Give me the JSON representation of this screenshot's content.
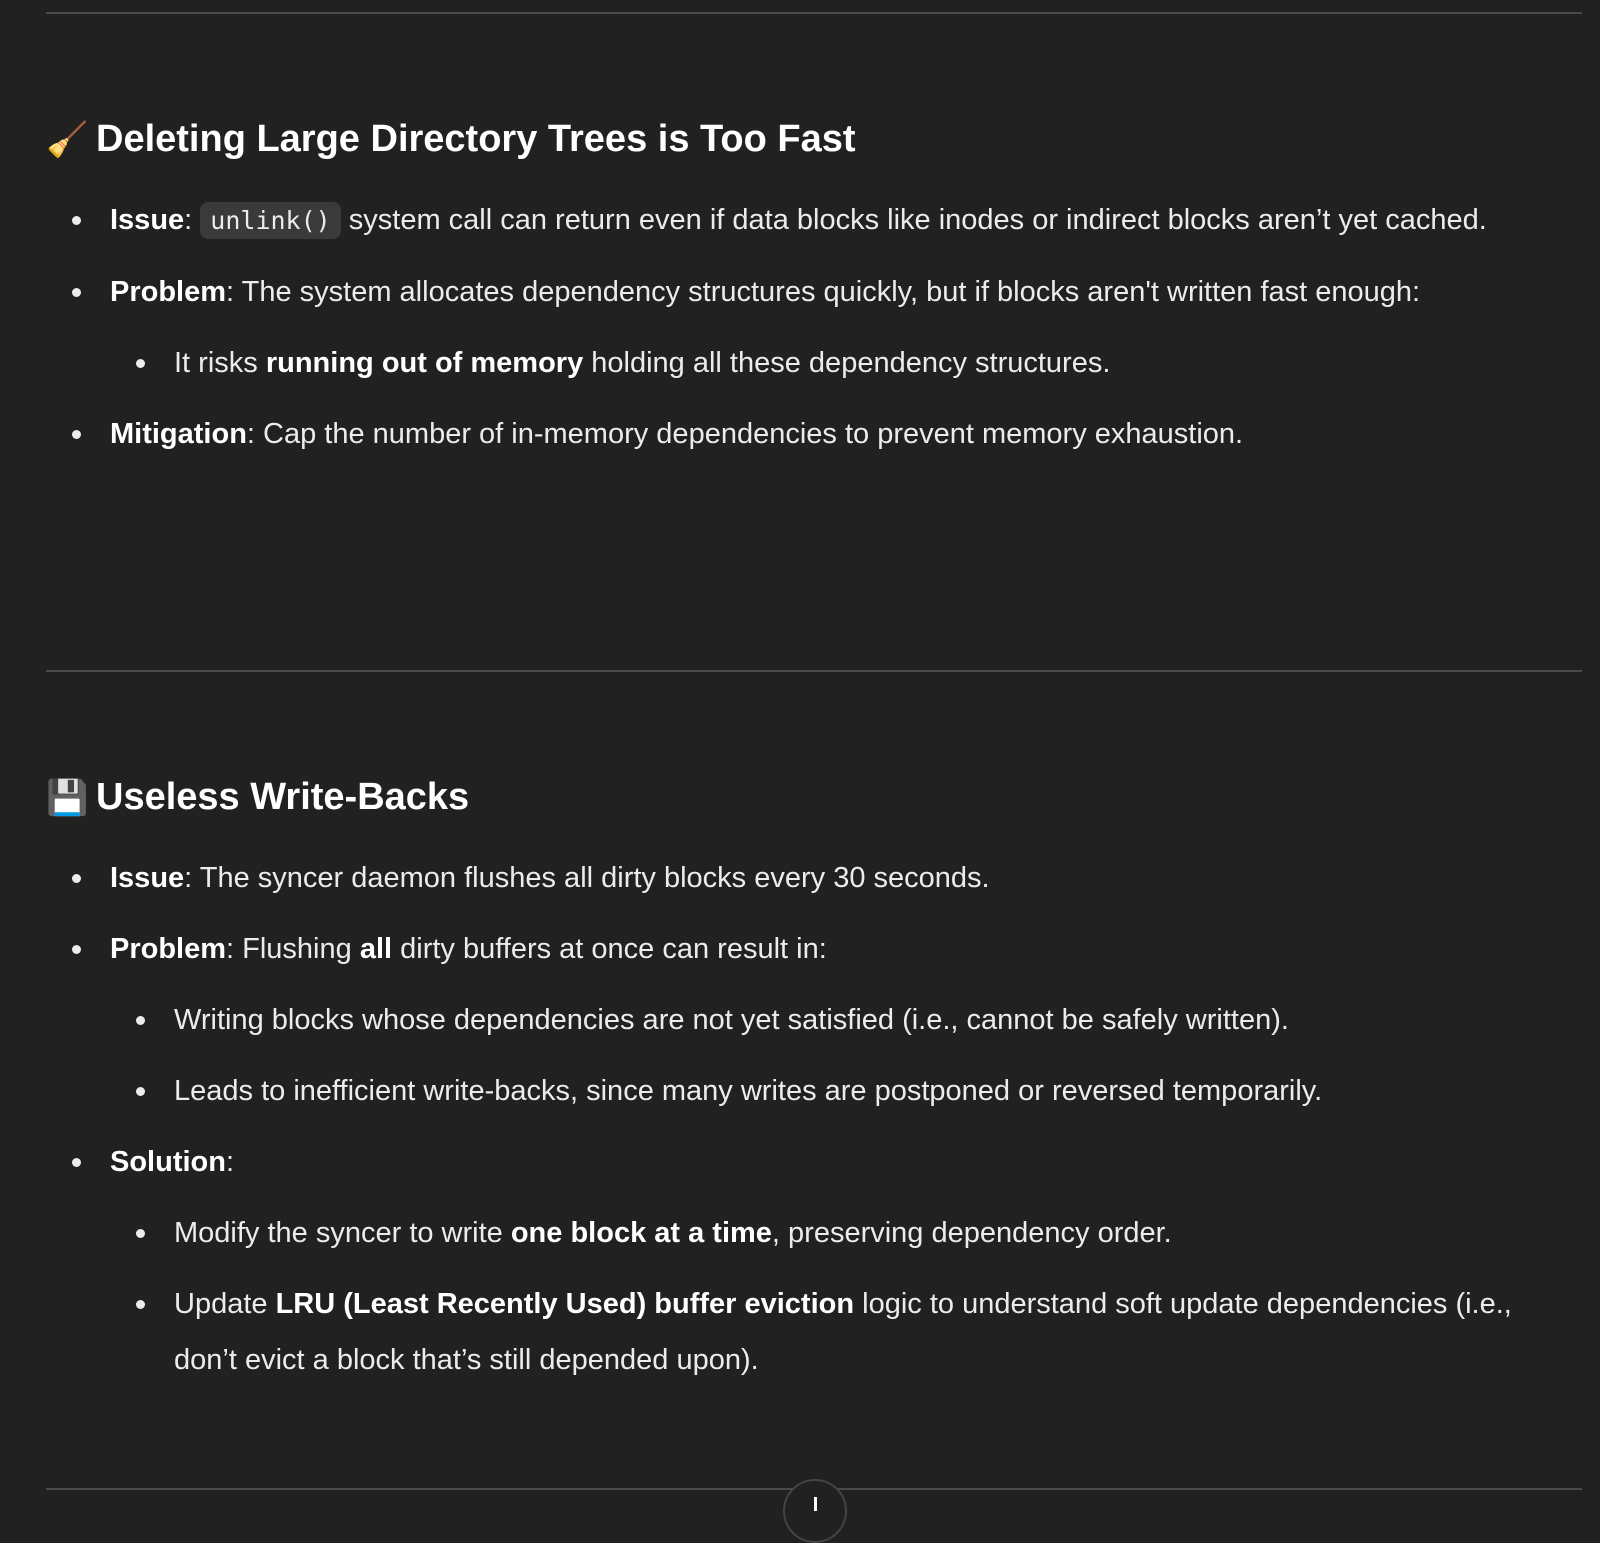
{
  "sections": [
    {
      "emoji": "🧹",
      "icon": "broom-icon",
      "title": "Deleting Large Directory Trees is Too Fast",
      "issue_label": "Issue",
      "issue_code": "unlink()",
      "issue_text": " system call can return even if data blocks like inodes or indirect blocks aren’t yet cached.",
      "problem_label": "Problem",
      "problem_text": ": The system allocates dependency structures quickly, but if blocks aren't written fast enough:",
      "problem_sub_pre": "It risks ",
      "problem_sub_bold": "running out of memory",
      "problem_sub_post": " holding all these dependency structures.",
      "mitigation_label": "Mitigation",
      "mitigation_text": ": Cap the number of in-memory dependencies to prevent memory exhaustion."
    },
    {
      "emoji": "💾",
      "icon": "floppy-disk-icon",
      "title": "Useless Write-Backs",
      "issue_label": "Issue",
      "issue_text": ": The syncer daemon flushes all dirty blocks every 30 seconds.",
      "problem_label": "Problem",
      "problem_pre": ": Flushing ",
      "problem_bold": "all",
      "problem_post": " dirty buffers at once can result in:",
      "problem_subs": [
        "Writing blocks whose dependencies are not yet satisfied (i.e., cannot be safely written).",
        "Leads to inefficient write-backs, since many writes are postponed or reversed temporarily."
      ],
      "solution_label": "Solution",
      "solution_colon": ":",
      "solution_sub1_pre": "Modify the syncer to write ",
      "solution_sub1_bold": "one block at a time",
      "solution_sub1_post": ", preserving dependency order.",
      "solution_sub2_pre": "Update ",
      "solution_sub2_bold": "LRU (Least Recently Used) buffer eviction",
      "solution_sub2_post": " logic to understand soft update dependencies (i.e., don’t evict a block that’s still depended upon)."
    }
  ],
  "colors": {
    "background": "#212121",
    "text": "#ececec",
    "code_bg": "#3a3a3a"
  }
}
